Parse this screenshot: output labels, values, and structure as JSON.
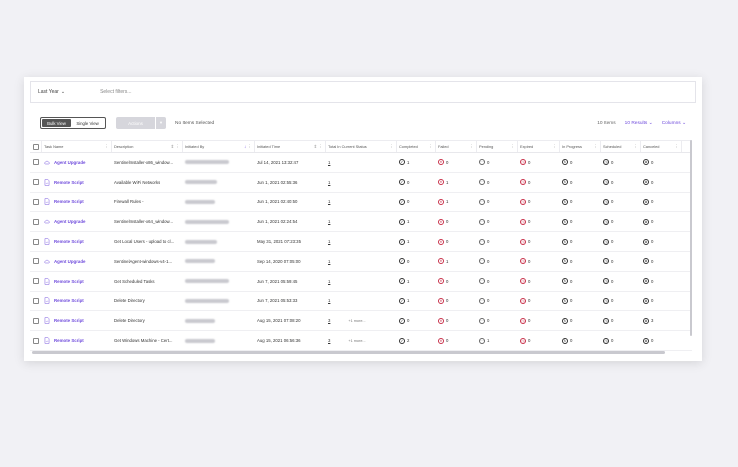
{
  "filters": {
    "date_range": "Last Year",
    "select_filters_placeholder": "Select filters..."
  },
  "toolbar": {
    "bulk_view": "Bulk View",
    "single_view": "Single View",
    "actions_label": "Actions",
    "no_items": "No Items Selected",
    "items_count": "10 Items",
    "results": "10 Results",
    "columns": "Columns"
  },
  "columns": [
    "Task Name",
    "Description",
    "Initiated By",
    "Initiated Time",
    "Total In Current Status",
    "Completed",
    "Failed",
    "Pending",
    "Expired",
    "In Progress",
    "Scheduled",
    "Canceled"
  ],
  "rows": [
    {
      "type": "upgrade",
      "name": "Agent Upgrade",
      "desc": "SentinelInstaller-x86_window...",
      "time": "Jul 14, 2021 13:32:47",
      "total": "1",
      "extra": "",
      "completed": "1",
      "failed": "0",
      "pending": "0",
      "expired": "0",
      "in_progress": "0",
      "scheduled": "0",
      "canceled": "0"
    },
    {
      "type": "script",
      "name": "Remote Script",
      "desc": "Available WiFi Networks",
      "time": "Jun 1, 2021 02:55:36",
      "total": "1",
      "extra": "",
      "completed": "0",
      "failed": "1",
      "pending": "0",
      "expired": "0",
      "in_progress": "0",
      "scheduled": "0",
      "canceled": "0"
    },
    {
      "type": "script",
      "name": "Remote Script",
      "desc": "Firewall Rules -",
      "time": "Jun 1, 2021 02:40:50",
      "total": "1",
      "extra": "",
      "completed": "0",
      "failed": "1",
      "pending": "0",
      "expired": "0",
      "in_progress": "0",
      "scheduled": "0",
      "canceled": "0"
    },
    {
      "type": "upgrade",
      "name": "Agent Upgrade",
      "desc": "SentinelInstaller-x64_window...",
      "time": "Jun 1, 2021 02:24:54",
      "total": "1",
      "extra": "",
      "completed": "1",
      "failed": "0",
      "pending": "0",
      "expired": "0",
      "in_progress": "0",
      "scheduled": "0",
      "canceled": "0"
    },
    {
      "type": "script",
      "name": "Remote Script",
      "desc": "Get Local Users - upload to cl...",
      "time": "May 31, 2021 07:23:35",
      "total": "1",
      "extra": "",
      "completed": "1",
      "failed": "0",
      "pending": "0",
      "expired": "0",
      "in_progress": "0",
      "scheduled": "0",
      "canceled": "0"
    },
    {
      "type": "upgrade",
      "name": "Agent Upgrade",
      "desc": "SentinelAgent-windows-v4-1...",
      "time": "Sep 14, 2020 07:05:00",
      "total": "1",
      "extra": "",
      "completed": "0",
      "failed": "1",
      "pending": "0",
      "expired": "0",
      "in_progress": "0",
      "scheduled": "0",
      "canceled": "0"
    },
    {
      "type": "script",
      "name": "Remote Script",
      "desc": "Get Scheduled Tasks",
      "time": "Jun 7, 2021 05:59:45",
      "total": "1",
      "extra": "",
      "completed": "1",
      "failed": "0",
      "pending": "0",
      "expired": "0",
      "in_progress": "0",
      "scheduled": "0",
      "canceled": "0"
    },
    {
      "type": "script",
      "name": "Remote Script",
      "desc": "Delete Directory",
      "time": "Jun 7, 2021 05:53:33",
      "total": "1",
      "extra": "",
      "completed": "1",
      "failed": "0",
      "pending": "0",
      "expired": "0",
      "in_progress": "0",
      "scheduled": "0",
      "canceled": "0"
    },
    {
      "type": "script",
      "name": "Remote Script",
      "desc": "Delete Directory",
      "time": "Aug 15, 2021 07:08:20",
      "total": "3",
      "extra": "+1 more...",
      "completed": "0",
      "failed": "0",
      "pending": "0",
      "expired": "0",
      "in_progress": "0",
      "scheduled": "0",
      "canceled": "3"
    },
    {
      "type": "script",
      "name": "Remote Script",
      "desc": "Get Windows Machine - Cert...",
      "time": "Aug 15, 2021 06:56:36",
      "total": "3",
      "extra": "+1 more...",
      "completed": "2",
      "failed": "0",
      "pending": "1",
      "expired": "0",
      "in_progress": "0",
      "scheduled": "0",
      "canceled": "0"
    }
  ],
  "colors": {
    "accent": "#6f4bdc",
    "failed": "#c8314a"
  }
}
